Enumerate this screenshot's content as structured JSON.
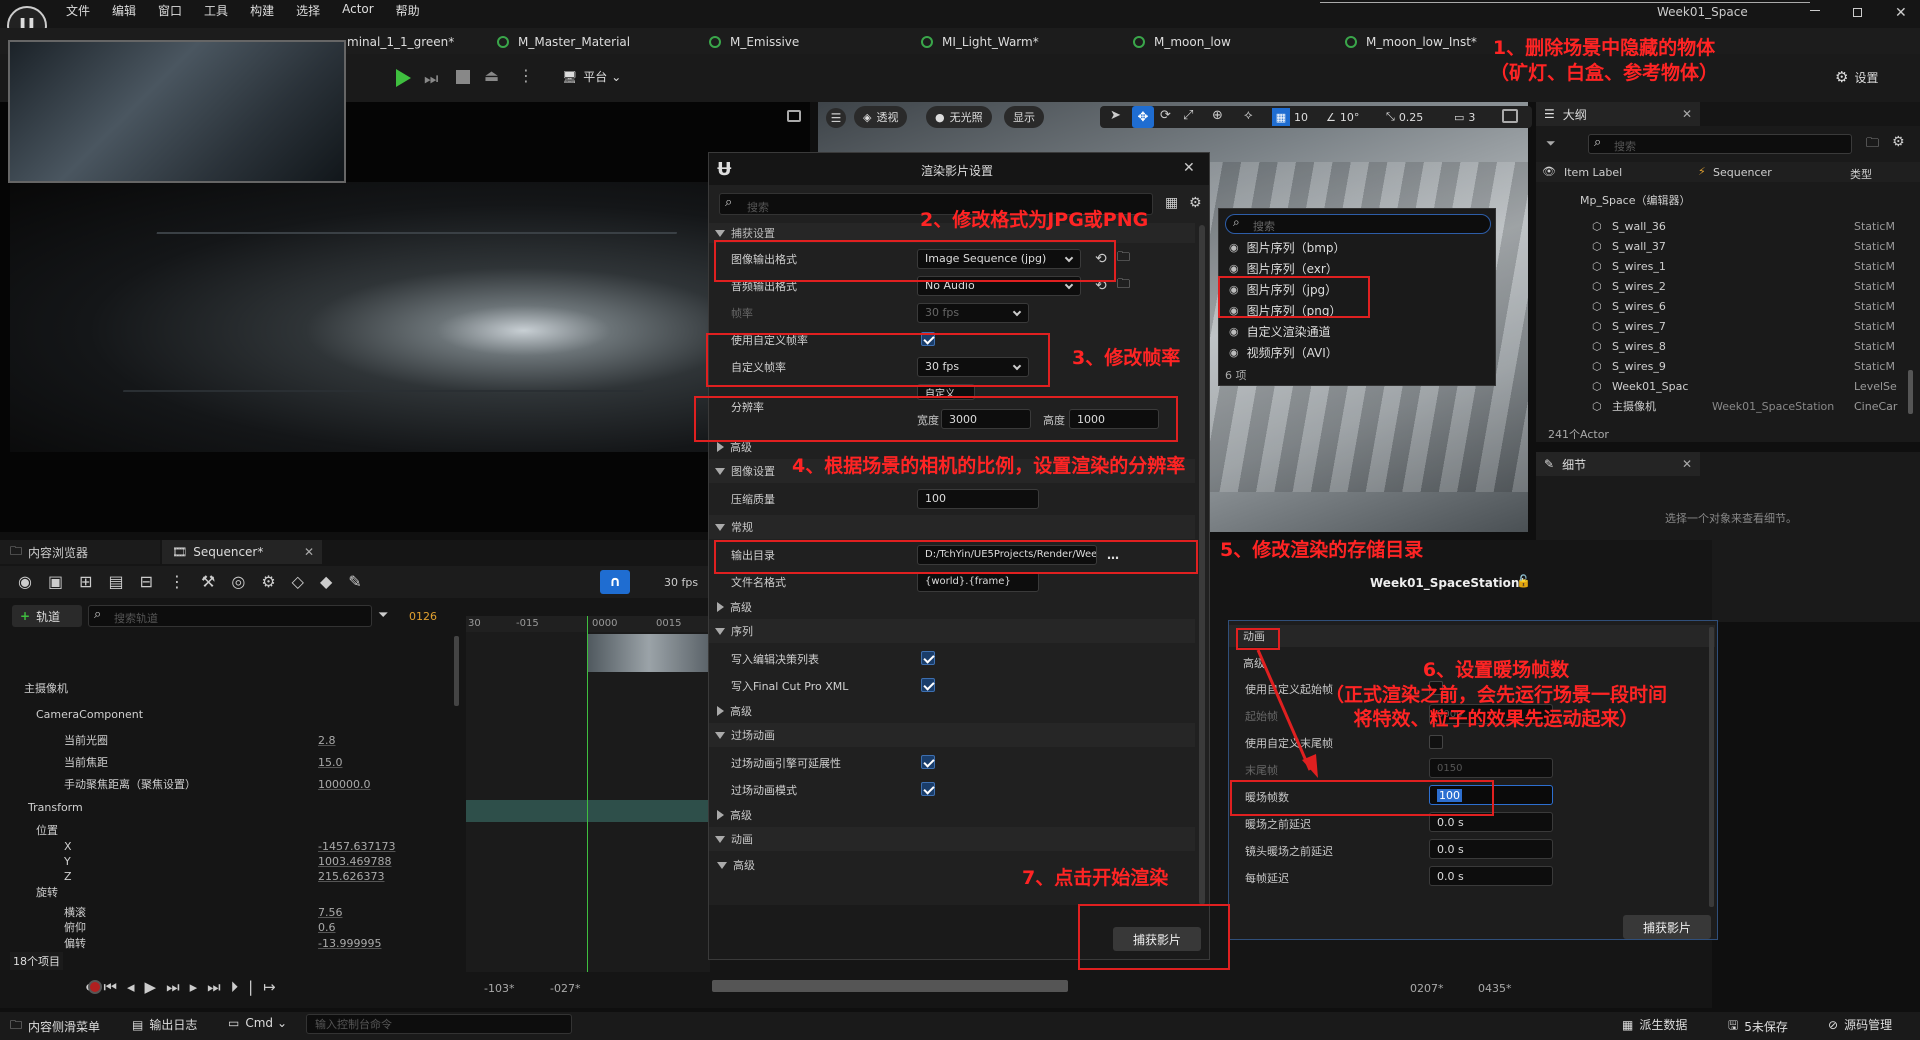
{
  "menu": [
    "文件",
    "编辑",
    "窗口",
    "工具",
    "构建",
    "选择",
    "Actor",
    "帮助"
  ],
  "window_title": "Week01_Space",
  "tabs": [
    "minal_1_1_green*",
    "M_Master_Material",
    "M_Emissive",
    "MI_Light_Warm*",
    "M_moon_low",
    "M_moon_low_Inst*"
  ],
  "toolbar": {
    "platform": "平台",
    "settings": "设置"
  },
  "viewport": {
    "perspective": "透视",
    "unlit": "无光照",
    "show": "显示",
    "grid": "10",
    "angle": "10°",
    "scale": "0.25",
    "cam": "3"
  },
  "dropdown": {
    "search_placeholder": "搜索",
    "items": [
      "图片序列（bmp）",
      "图片序列（exr）",
      "图片序列（jpg）",
      "图片序列（png）",
      "自定义渲染通道",
      "视频序列（AVI）"
    ],
    "count": "6 项"
  },
  "outliner": {
    "title": "大纲",
    "search_placeholder": "搜索",
    "col_label": "Item Label",
    "col_seq": "Sequencer",
    "col_type": "类型",
    "root": "Mp_Space（编辑器）",
    "rows": [
      {
        "name": "S_wall_36",
        "seq": "",
        "type": "StaticM"
      },
      {
        "name": "S_wall_37",
        "seq": "",
        "type": "StaticM"
      },
      {
        "name": "S_wires_1",
        "seq": "",
        "type": "StaticM"
      },
      {
        "name": "S_wires_2",
        "seq": "",
        "type": "StaticM"
      },
      {
        "name": "S_wires_6",
        "seq": "",
        "type": "StaticM"
      },
      {
        "name": "S_wires_7",
        "seq": "",
        "type": "StaticM"
      },
      {
        "name": "S_wires_8",
        "seq": "",
        "type": "StaticM"
      },
      {
        "name": "S_wires_9",
        "seq": "",
        "type": "StaticM"
      },
      {
        "name": "Week01_Spac",
        "seq": "",
        "type": "LevelSe"
      },
      {
        "name": "主摄像机",
        "seq": "Week01_SpaceStation",
        "type": "CineCar"
      }
    ],
    "count": "241个Actor"
  },
  "details": {
    "title": "细节",
    "empty": "选择一个对象来查看细节。"
  },
  "dialog": {
    "title": "渲染影片设置",
    "search_placeholder": "搜索",
    "sec_capture": "捕获设置",
    "image_format_label": "图像输出格式",
    "image_format": "Image Sequence (jpg)",
    "audio_label": "音频输出格式",
    "audio": "No Audio",
    "fps_label": "帧率",
    "fps": "30 fps",
    "custom_fps_label": "使用自定义帧率",
    "custom_fps_rate_label": "自定义帧率",
    "custom_fps": "30 fps",
    "res_label": "分辨率",
    "res_preset": "自定义",
    "width_label": "宽度",
    "width": "3000",
    "height_label": "高度",
    "height": "1000",
    "advanced": "高级",
    "sec_image": "图像设置",
    "quality_label": "压缩质量",
    "quality": "100",
    "sec_general": "常规",
    "out_dir_label": "输出目录",
    "out_dir": "D:/TchYin/UE5Projects/Render/Week01",
    "filename_label": "文件名格式",
    "filename": "{world}.{frame}",
    "sec_seq": "序列",
    "write_edl": "写入编辑决策列表",
    "write_fcp": "写入Final Cut Pro XML",
    "sec_cine": "过场动画",
    "cine_ext": "过场动画引擎可延展性",
    "cine_mode": "过场动画模式",
    "sec_anim": "动画",
    "capture": "捕获影片"
  },
  "anim_panel": {
    "title": "Week01_SpaceStation*",
    "sec": "动画",
    "advanced": "高级",
    "custom_start": "使用自定义起始帧",
    "start_label": "起始帧",
    "start": "0000",
    "custom_end": "使用自定义末尾帧",
    "end_label": "末尾帧",
    "end": "0150",
    "warmup_label": "暖场帧数",
    "warmup": "100",
    "delay_before_warmup": "暖场之前延迟",
    "delay_before_warmup_v": "0.0 s",
    "delay_shot": "镜头暖场之前延迟",
    "delay_shot_v": "0.0 s",
    "delay_frame": "每帧延迟",
    "delay_frame_v": "0.0 s",
    "capture": "捕获影片"
  },
  "sequencer": {
    "tab_content": "内容浏览器",
    "tab_seq": "Sequencer*",
    "fps": "30 fps",
    "add_track": "轨道",
    "search_placeholder": "搜索轨道",
    "frame": "0126",
    "ruler": [
      "30",
      "-015",
      "0000",
      "0015"
    ],
    "tracks": [
      {
        "label": "主摄像机",
        "value": ""
      },
      {
        "label": "CameraComponent",
        "value": ""
      },
      {
        "label": "当前光圈",
        "value": "2.8"
      },
      {
        "label": "当前焦距",
        "value": "15.0"
      },
      {
        "label": "手动聚焦距离（聚焦设置）",
        "value": "100000.0"
      },
      {
        "label": "Transform",
        "value": ""
      },
      {
        "label": "位置",
        "value": ""
      },
      {
        "label": "X",
        "value": "-1457.637173"
      },
      {
        "label": "Y",
        "value": "1003.469788"
      },
      {
        "label": "Z",
        "value": "215.626373"
      },
      {
        "label": "旋转",
        "value": ""
      },
      {
        "label": "横滚",
        "value": "7.56"
      },
      {
        "label": "俯仰",
        "value": "0.6"
      },
      {
        "label": "偏转",
        "value": "-13.999995"
      }
    ],
    "count": "18个项目",
    "start": "-103*",
    "start2": "-027*",
    "end": "0207*",
    "end2": "0435*"
  },
  "statusbar": {
    "drawer": "内容侧滑菜单",
    "log": "输出日志",
    "cmd": "Cmd",
    "cmd_placeholder": "输入控制台命令",
    "derived": "派生数据",
    "unsaved": "5未保存",
    "source": "源码管理"
  },
  "annotations": [
    "1、删除场景中隐藏的物体\n（矿灯、白盒、参考物体）",
    "2、修改格式为JPG或PNG",
    "3、修改帧率",
    "4、根据场景的相机的比例，设置渲染的分辨率",
    "5、修改渲染的存储目录",
    "6、设置暖场帧数\n（正式渲染之前，会先运行场景一段时间\n将特效、粒子的效果先运动起来）",
    "7、点击开始渲染"
  ]
}
